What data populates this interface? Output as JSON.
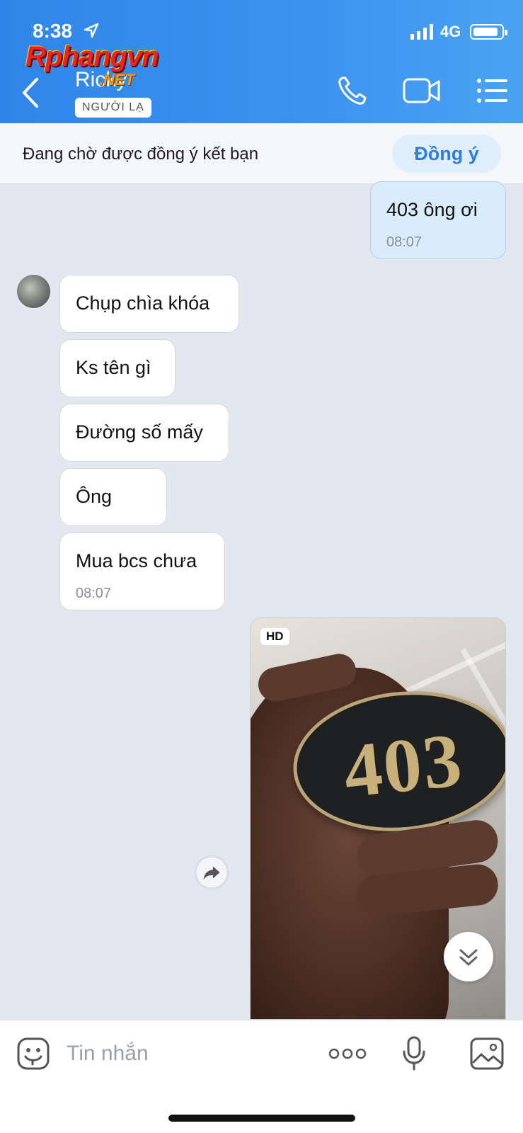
{
  "status_bar": {
    "time": "8:38",
    "network": "4G",
    "icons": [
      "location-arrow-icon",
      "signal-icon",
      "battery-icon"
    ]
  },
  "watermark": {
    "brand": "Rphangvn",
    "suffix": ".NET"
  },
  "header": {
    "contact_name": "Ricky",
    "badge": "NGƯỜI LẠ",
    "icons": [
      "back-icon",
      "phone-icon",
      "video-call-icon",
      "menu-icon"
    ],
    "accent_color": "#3d92f0"
  },
  "friend_request": {
    "text": "Đang chờ được đồng ý kết bạn",
    "accept_label": "Đồng ý"
  },
  "messages": [
    {
      "direction": "out",
      "text": "403 ông ơi",
      "time": "08:07"
    },
    {
      "direction": "in",
      "text": "Chụp chìa khóa"
    },
    {
      "direction": "in",
      "text": "Ks tên gì"
    },
    {
      "direction": "in",
      "text": "Đường số mấy"
    },
    {
      "direction": "in",
      "text": "Ông"
    },
    {
      "direction": "in",
      "text": "Mua bcs chưa",
      "time": "08:07"
    }
  ],
  "photo_message": {
    "direction": "out",
    "badge": "HD",
    "tag_number": "403"
  },
  "composer": {
    "placeholder": "Tin nhắn",
    "value": "",
    "icons": [
      "emoji-icon",
      "more-icon",
      "microphone-icon",
      "gallery-icon"
    ]
  }
}
